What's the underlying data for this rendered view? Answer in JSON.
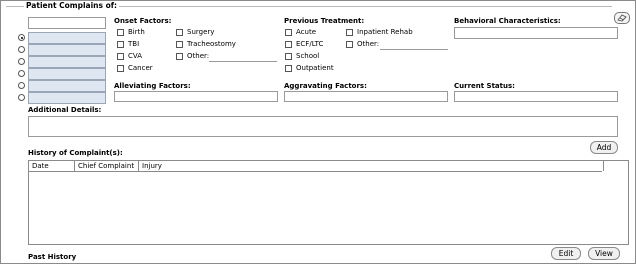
{
  "section": {
    "title": "Patient Complains of:",
    "eraser_icon": "eraser-icon"
  },
  "complaints": {
    "rows": 6,
    "selected_index": 0
  },
  "onset": {
    "label": "Onset Factors:",
    "col1": [
      "Birth",
      "TBI",
      "CVA",
      "Cancer"
    ],
    "col2": [
      "Surgery",
      "Tracheostomy",
      "Other:"
    ]
  },
  "treatment": {
    "label": "Previous Treatment:",
    "col1": [
      "Acute",
      "ECF/LTC",
      "School",
      "Outpatient"
    ],
    "col2": [
      "Inpatient Rehab",
      "Other:"
    ]
  },
  "behavioral": {
    "label": "Behavioral Characteristics:"
  },
  "alleviating": {
    "label": "Alleviating Factors:"
  },
  "aggravating": {
    "label": "Aggravating Factors:"
  },
  "current_status": {
    "label": "Current Status:"
  },
  "additional": {
    "label": "Additional Details:"
  },
  "history": {
    "label": "History of Complaint(s):",
    "add_label": "Add",
    "columns": [
      "Date",
      "Chief Complaint",
      "Injury"
    ]
  },
  "past_history": {
    "label": "Past History"
  },
  "footer": {
    "edit_label": "Edit",
    "view_label": "View"
  }
}
